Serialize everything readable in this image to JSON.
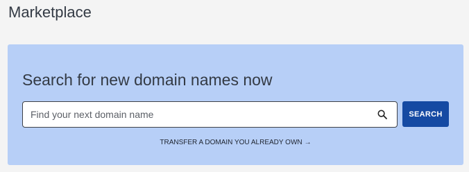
{
  "page": {
    "title": "Marketplace"
  },
  "search_card": {
    "heading": "Search for new domain names now",
    "input": {
      "placeholder": "Find your next domain name",
      "value": ""
    },
    "search_icon": "search-icon",
    "search_button_label": "SEARCH",
    "transfer_link_label": "TRANSFER A DOMAIN YOU ALREADY OWN",
    "transfer_arrow": "→"
  },
  "colors": {
    "page_background": "#f4f4f4",
    "card_background": "#b7cff7",
    "button_background": "#154aa3",
    "text": "#333a44"
  }
}
